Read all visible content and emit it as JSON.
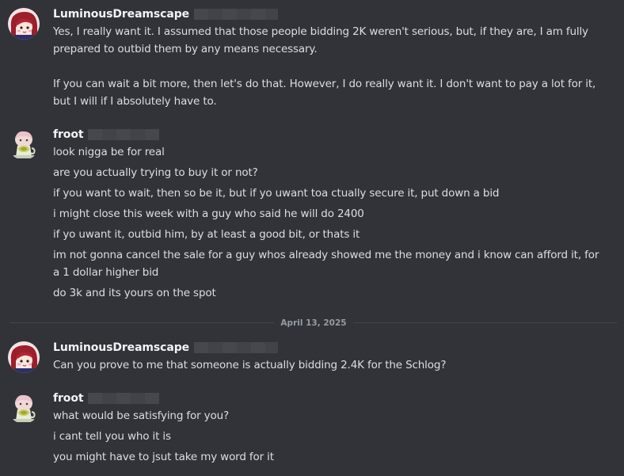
{
  "messages": [
    {
      "author": "LuminousDreamscape",
      "avatar": "anime-avatar-red-hair",
      "lines": [
        "Yes, I really want it.  I assumed that those people bidding 2K weren't serious, but, if they are, I am fully",
        "prepared to outbid them by any means necessary.",
        "If you can wait a bit more, then let's do that.  However, I do really want it.  I don't want to pay a lot for it,",
        "but I will if I absolutely have to."
      ]
    },
    {
      "author": "froot",
      "avatar": "anime-avatar-tea-cup",
      "lines": [
        "look nigga be for real",
        "are you actually trying to buy it or not?",
        "if you want to wait, then so be it, but if yo uwant toa ctually secure it, put down a bid",
        "i might close this week with a guy who said he will do 2400",
        "if yo uwant it, outbid him, by at least a good bit, or thats it",
        "im not gonna cancel the sale for a guy whos already showed me the money and i know can afford it, for",
        "a 1 dollar higher bid",
        "do 3k and its yours on the spot"
      ]
    },
    {
      "author": "LuminousDreamscape",
      "avatar": "anime-avatar-red-hair",
      "lines": [
        "Can you prove to me that someone is actually bidding 2.4K for the Schlog?"
      ]
    },
    {
      "author": "froot",
      "avatar": "anime-avatar-tea-cup",
      "lines": [
        "what would be satisfying for you?",
        "i cant tell you who it is",
        "you might have to jsut take my word for it"
      ]
    }
  ],
  "date_divider": "April 13, 2025",
  "colors": {
    "background": "#323339",
    "text": "#dbdee1",
    "username": "#f2f3f5",
    "divider": "#45464d",
    "divider_label": "#959ba3"
  }
}
